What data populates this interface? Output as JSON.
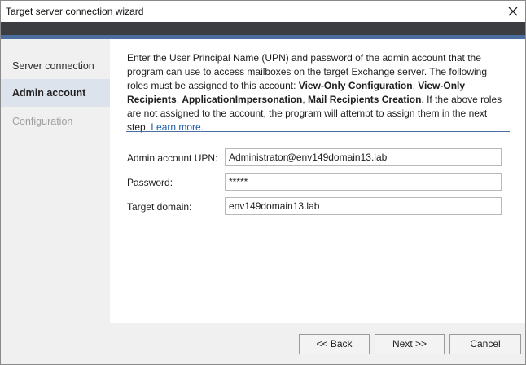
{
  "window": {
    "title": "Target server connection wizard"
  },
  "sidebar": {
    "items": [
      {
        "label": "Server connection",
        "state": "normal"
      },
      {
        "label": "Admin account",
        "state": "active"
      },
      {
        "label": "Configuration",
        "state": "disabled"
      }
    ]
  },
  "main": {
    "description": {
      "part1": "Enter the User Principal Name (UPN) and password of the admin account that the program can use to access mailboxes on the target Exchange server. The following roles must be assigned to this account: ",
      "role1": "View-Only Configuration",
      "sep1": ", ",
      "role2": "View-Only Recipients",
      "sep2": ", ",
      "role3": "ApplicationImpersonation",
      "sep3": ", ",
      "role4": "Mail Recipients Creation",
      "part2": ". If the above roles are not assigned to the account, the program will attempt to assign them in the next step.",
      "learn_more": "Learn more."
    },
    "form": {
      "upn_label": "Admin account UPN:",
      "upn_value": "Administrator@env149domain13.lab",
      "password_label": "Password:",
      "password_value": "*****",
      "domain_label": "Target domain:",
      "domain_value": "env149domain13.lab"
    }
  },
  "footer": {
    "back_label": "<< Back",
    "next_label": "Next >>",
    "cancel_label": "Cancel"
  },
  "colors": {
    "accent": "#4c6e9f",
    "dark_band": "#3b3d40",
    "link": "#1a5aa8",
    "active_nav_bg": "#dde3ec"
  },
  "icons": {
    "close": "close-icon"
  }
}
